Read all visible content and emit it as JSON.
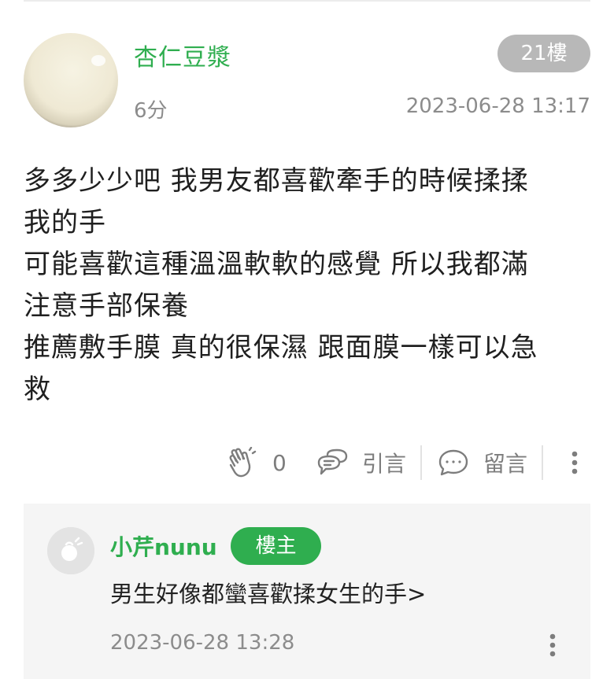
{
  "post": {
    "author": "杏仁豆漿",
    "floor": "21樓",
    "age": "6分",
    "timestamp": "2023-06-28 13:17",
    "content": [
      "多多少少吧 我男友都喜歡牽手的時候揉揉",
      "我的手",
      "可能喜歡這種溫溫軟軟的感覺 所以我都滿",
      "注意手部保養",
      "推薦敷手膜 真的很保濕 跟面膜一樣可以急",
      "救"
    ],
    "actions": {
      "like_count": "0",
      "quote_label": "引言",
      "comment_label": "留言"
    }
  },
  "reply": {
    "author": "小芹nunu",
    "badge": "樓主",
    "text": "男生好像都蠻喜歡揉女生的手>",
    "timestamp": "2023-06-28 13:28"
  },
  "colors": {
    "accent": "#2fae4f",
    "muted": "#8c8c8c",
    "floor_badge": "#b8b8b8",
    "reply_bg": "#f5f5f5"
  }
}
